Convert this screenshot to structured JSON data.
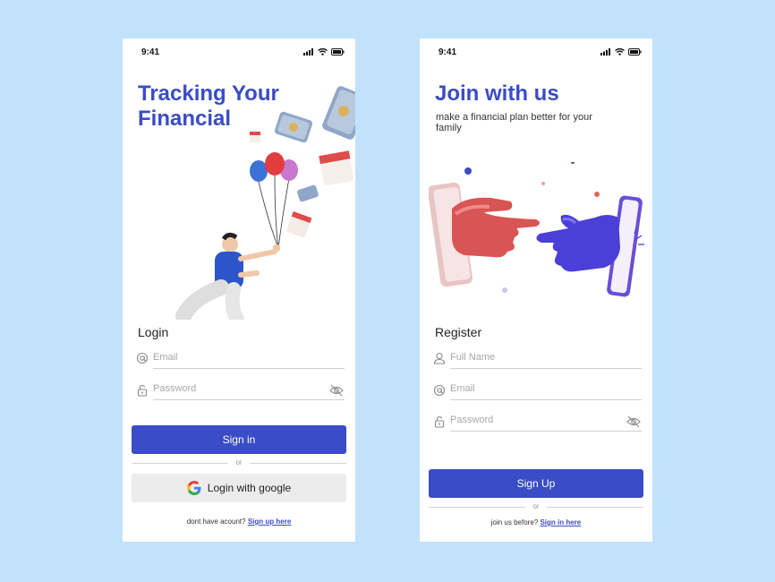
{
  "status": {
    "time": "9:41"
  },
  "login": {
    "title_line1": "Tracking Your",
    "title_line2": "Financial",
    "section_label": "Login",
    "email_placeholder": "Email",
    "password_placeholder": "Password",
    "signin_label": "Sign in",
    "divider_text": "or",
    "google_label": "Login with google",
    "footer_text": "dont have acount?",
    "footer_link": "Sign up here"
  },
  "register": {
    "title": "Join with us",
    "subtitle": "make a financial plan better for your family",
    "section_label": "Register",
    "fullname_placeholder": "Full Name",
    "email_placeholder": "Email",
    "password_placeholder": "Password",
    "signup_label": "Sign Up",
    "divider_text": "or",
    "footer_text": "join us before?",
    "footer_link": "Sign in here"
  },
  "colors": {
    "accent": "#3a4cc6",
    "background": "#c2e1fb",
    "google_button": "#ececec"
  }
}
